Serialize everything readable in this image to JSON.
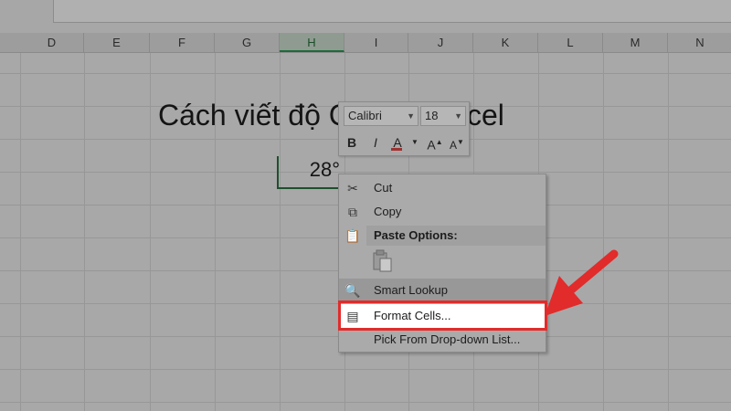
{
  "columns": [
    "D",
    "E",
    "F",
    "G",
    "H",
    "I",
    "J",
    "K",
    "L",
    "M",
    "N"
  ],
  "selected_column": "H",
  "sheet": {
    "title_text": "Cách viết độ C trong Excel",
    "active_cell_value": "28°"
  },
  "mini_toolbar": {
    "font_name": "Calibri",
    "font_size": "18",
    "bold": "B",
    "italic": "I",
    "font_color": "A",
    "grow": "A",
    "shrink": "A"
  },
  "context_menu": {
    "cut": "Cut",
    "copy": "Copy",
    "paste_options": "Paste Options:",
    "smart_lookup": "Smart Lookup",
    "format_cells": "Format Cells...",
    "pick_list": "Pick From Drop-down List..."
  },
  "colors": {
    "highlight": "#e22b2b",
    "selection": "#1d6b3a"
  }
}
